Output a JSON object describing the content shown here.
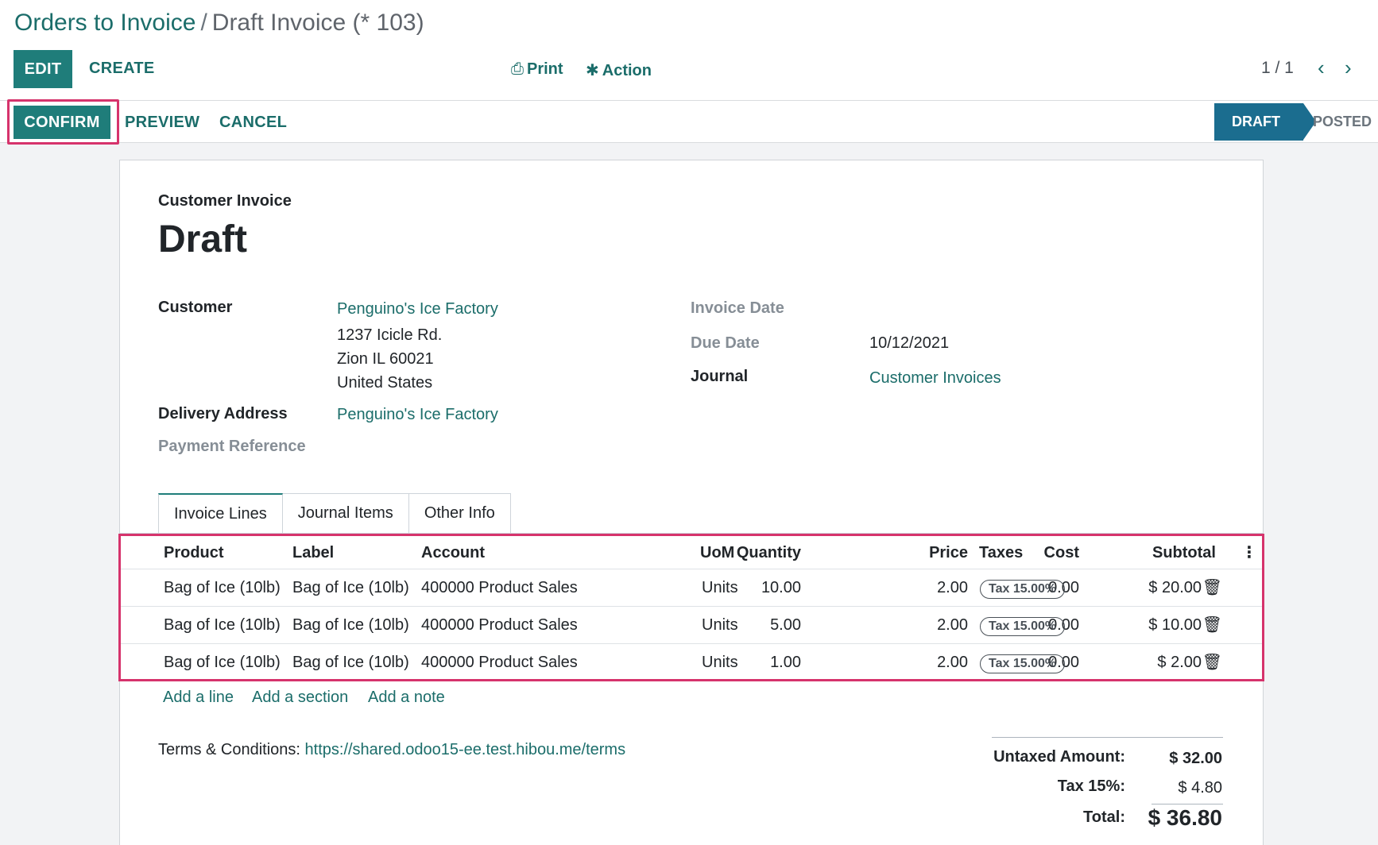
{
  "breadcrumb": {
    "parent": "Orders to Invoice",
    "separator": "/",
    "current": "Draft Invoice (* 103)"
  },
  "toolbar": {
    "edit_label": "EDIT",
    "create_label": "CREATE",
    "print_label": "Print",
    "action_label": "Action",
    "pager": "1 / 1"
  },
  "statusbar": {
    "confirm_label": "CONFIRM",
    "preview_label": "PREVIEW",
    "cancel_label": "CANCEL",
    "stages": [
      "DRAFT",
      "POSTED"
    ]
  },
  "invoice": {
    "type_label": "Customer Invoice",
    "name": "Draft",
    "customer_label": "Customer",
    "customer_name": "Penguino's Ice Factory",
    "address_line1": "1237 Icicle Rd.",
    "address_line2": "Zion IL 60021",
    "address_line3": "United States",
    "delivery_label": "Delivery Address",
    "delivery_value": "Penguino's Ice Factory",
    "payment_ref_label": "Payment Reference",
    "invoice_date_label": "Invoice Date",
    "due_date_label": "Due Date",
    "due_date_value": "10/12/2021",
    "journal_label": "Journal",
    "journal_value": "Customer Invoices"
  },
  "tabs": [
    "Invoice Lines",
    "Journal Items",
    "Other Info"
  ],
  "lines": {
    "headers": {
      "product": "Product",
      "label": "Label",
      "account": "Account",
      "quantity": "Quantity",
      "uom": "UoM",
      "price": "Price",
      "cost": "Cost",
      "taxes": "Taxes",
      "subtotal": "Subtotal"
    },
    "rows": [
      {
        "product": "Bag of Ice (10lb)",
        "label": "Bag of Ice (10lb)",
        "account": "400000 Product Sales",
        "quantity": "10.00",
        "uom": "Units",
        "price": "2.00",
        "cost": "0.00",
        "tax": "Tax 15.00%",
        "subtotal": "$ 20.00"
      },
      {
        "product": "Bag of Ice (10lb)",
        "label": "Bag of Ice (10lb)",
        "account": "400000 Product Sales",
        "quantity": "5.00",
        "uom": "Units",
        "price": "2.00",
        "cost": "0.00",
        "tax": "Tax 15.00%",
        "subtotal": "$ 10.00"
      },
      {
        "product": "Bag of Ice (10lb)",
        "label": "Bag of Ice (10lb)",
        "account": "400000 Product Sales",
        "quantity": "1.00",
        "uom": "Units",
        "price": "2.00",
        "cost": "0.00",
        "tax": "Tax 15.00%",
        "subtotal": "$ 2.00"
      }
    ],
    "add_line": "Add a line",
    "add_section": "Add a section",
    "add_note": "Add a note"
  },
  "terms": {
    "label": "Terms & Conditions:",
    "url": "https://shared.odoo15-ee.test.hibou.me/terms"
  },
  "totals": {
    "untaxed_label": "Untaxed Amount:",
    "untaxed_value": "$ 32.00",
    "tax_label": "Tax 15%:",
    "tax_value": "$ 4.80",
    "total_label": "Total:",
    "total_value": "$ 36.80"
  },
  "colors": {
    "primary": "#1f7d7a",
    "link": "#1b6d6a",
    "stage_active": "#1b6d8f",
    "highlight": "#d6336c"
  },
  "icons": {
    "print": "print-icon",
    "action": "gear-icon",
    "prev": "chevron-left-icon",
    "next": "chevron-right-icon",
    "delete": "trash-icon",
    "options": "kebab-icon"
  }
}
